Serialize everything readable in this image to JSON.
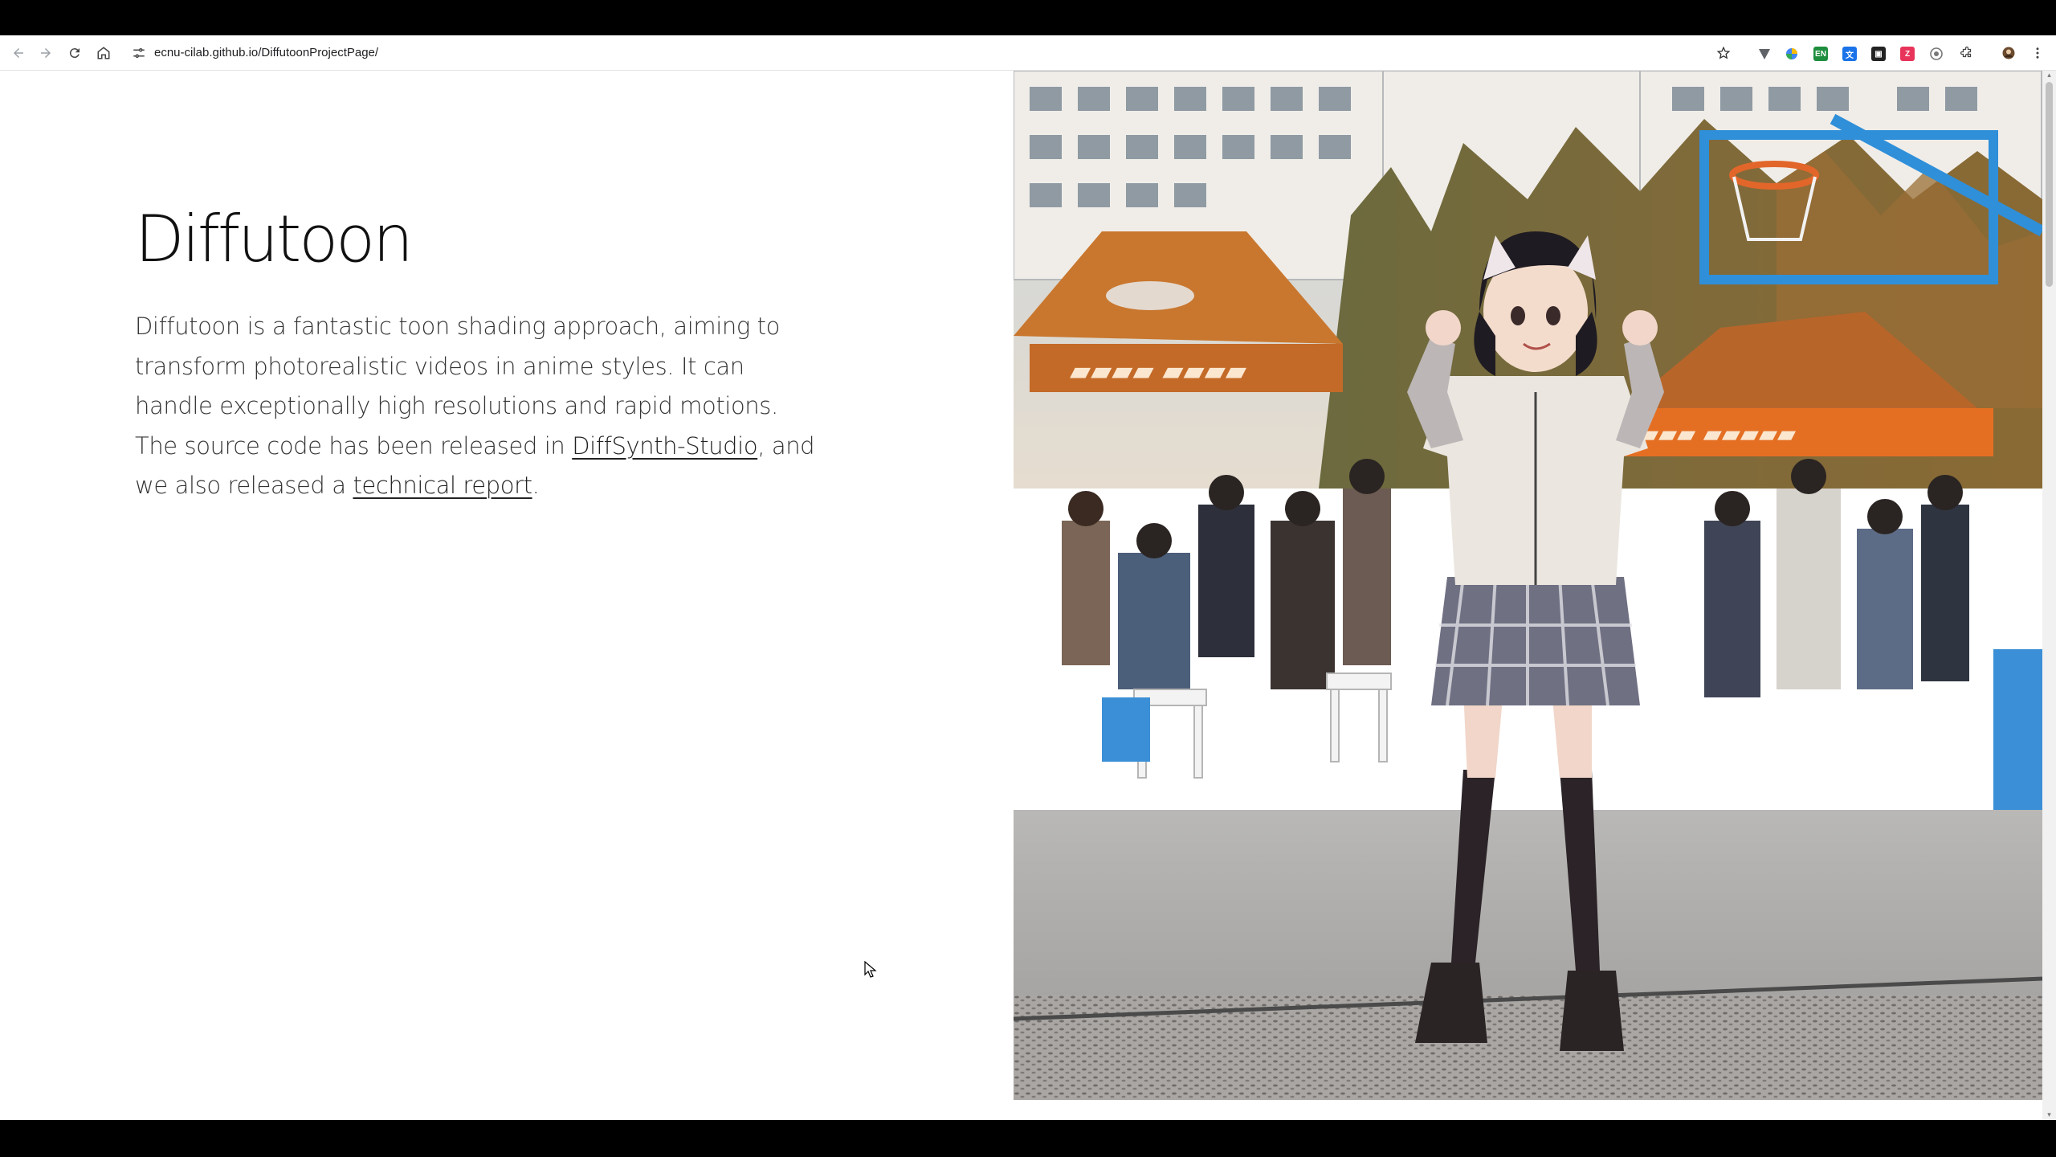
{
  "browser": {
    "url": "ecnu-cilab.github.io/DiffutoonProjectPage/",
    "back_icon": "back-arrow-icon",
    "forward_icon": "forward-arrow-icon",
    "reload_icon": "reload-icon",
    "home_icon": "home-icon",
    "site_info_icon": "tune-icon",
    "bookmark_icon": "star-icon",
    "extensions_icon": "puzzle-icon",
    "menu_icon": "kebab-menu-icon"
  },
  "page": {
    "title": "Diffutoon",
    "description_part1": "Diffutoon is a fantastic toon shading approach, aiming to transform photorealistic videos in anime styles. It can handle exceptionally high resolutions and rapid motions. The source code has been released in ",
    "link_diffsynth": "DiffSynth-Studio",
    "description_part2": ", and we also released a ",
    "link_report": "technical report",
    "description_part3": ".",
    "hero_image_alt": "anime-style girl dancing on a basketball court"
  },
  "colors": {
    "accent_blue": "#1a73e8",
    "text_dark": "#111111"
  }
}
